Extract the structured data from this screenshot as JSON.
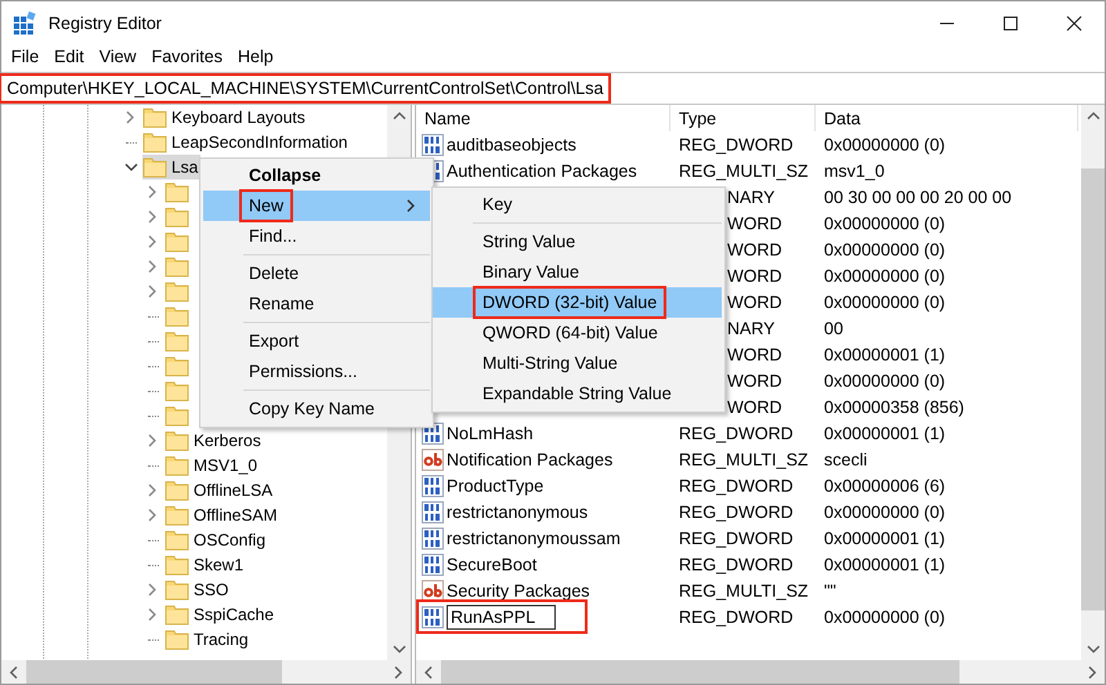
{
  "window": {
    "title": "Registry Editor"
  },
  "menu_bar": [
    "File",
    "Edit",
    "View",
    "Favorites",
    "Help"
  ],
  "address_bar": {
    "value": "Computer\\HKEY_LOCAL_MACHINE\\SYSTEM\\CurrentControlSet\\Control\\Lsa",
    "callout": true
  },
  "tree": {
    "items": [
      {
        "label": "Keyboard Layouts",
        "expandable": true,
        "expanded": false,
        "selected": false
      },
      {
        "label": "LeapSecondInformation",
        "expandable": false,
        "selected": false
      },
      {
        "label": "Lsa",
        "expandable": true,
        "expanded": true,
        "selected": true,
        "children": [
          {
            "expandable": true,
            "expanded": false,
            "selected": false
          },
          {
            "expandable": true,
            "expanded": false,
            "selected": false
          },
          {
            "expandable": true,
            "expanded": false,
            "selected": false
          },
          {
            "expandable": true,
            "expanded": false,
            "selected": false
          },
          {
            "expandable": true,
            "expanded": false,
            "selected": false
          },
          {
            "expandable": false,
            "selected": false
          },
          {
            "expandable": false,
            "selected": false
          },
          {
            "expandable": false,
            "selected": false
          },
          {
            "expandable": false,
            "selected": false
          },
          {
            "expandable": false,
            "selected": false
          },
          {
            "label": "Kerberos",
            "expandable": true,
            "expanded": false,
            "selected": false
          },
          {
            "label": "MSV1_0",
            "expandable": false,
            "selected": false
          },
          {
            "label": "OfflineLSA",
            "expandable": true,
            "expanded": false,
            "selected": false
          },
          {
            "label": "OfflineSAM",
            "expandable": true,
            "expanded": false,
            "selected": false
          },
          {
            "label": "OSConfig",
            "expandable": false,
            "selected": false
          },
          {
            "label": "Skew1",
            "expandable": false,
            "selected": false
          },
          {
            "label": "SSO",
            "expandable": true,
            "expanded": false,
            "selected": false
          },
          {
            "label": "SspiCache",
            "expandable": true,
            "expanded": false,
            "selected": false
          },
          {
            "label": "Tracing",
            "expandable": false,
            "selected": false
          }
        ]
      }
    ]
  },
  "values": {
    "columns": [
      "Name",
      "Type",
      "Data"
    ],
    "rows": [
      {
        "name": "auditbaseobjects",
        "type": "REG_DWORD",
        "data": "0x00000000 (0)",
        "kind": "binary",
        "covered": false
      },
      {
        "name": "Authentication Packages",
        "type": "REG_MULTI_SZ",
        "data": "msv1_0",
        "kind": "binary",
        "covered": false
      },
      {
        "type": "NARY",
        "data": "00 30 00 00 00 20 00 00",
        "covered": true
      },
      {
        "type": "WORD",
        "data": "0x00000000 (0)",
        "covered": true
      },
      {
        "type": "WORD",
        "data": "0x00000000 (0)",
        "covered": true
      },
      {
        "type": "WORD",
        "data": "0x00000000 (0)",
        "covered": true
      },
      {
        "type": "WORD",
        "data": "0x00000000 (0)",
        "covered": true
      },
      {
        "type": "NARY",
        "data": "00",
        "covered": true
      },
      {
        "type": "WORD",
        "data": "0x00000001 (1)",
        "covered": true
      },
      {
        "type": "WORD",
        "data": "0x00000000 (0)",
        "covered": true
      },
      {
        "type": "WORD",
        "data": "0x00000358 (856)",
        "covered": true
      },
      {
        "name": "NoLmHash",
        "type": "REG_DWORD",
        "data": "0x00000001 (1)",
        "kind": "binary",
        "covered": false
      },
      {
        "name": "Notification Packages",
        "type": "REG_MULTI_SZ",
        "data": "scecli",
        "kind": "string",
        "covered": false
      },
      {
        "name": "ProductType",
        "type": "REG_DWORD",
        "data": "0x00000006 (6)",
        "kind": "binary",
        "covered": false
      },
      {
        "name": "restrictanonymous",
        "type": "REG_DWORD",
        "data": "0x00000000 (0)",
        "kind": "binary",
        "covered": false
      },
      {
        "name": "restrictanonymoussam",
        "type": "REG_DWORD",
        "data": "0x00000001 (1)",
        "kind": "binary",
        "covered": false
      },
      {
        "name": "SecureBoot",
        "type": "REG_DWORD",
        "data": "0x00000001 (1)",
        "kind": "binary",
        "covered": false
      },
      {
        "name": "Security Packages",
        "type": "REG_MULTI_SZ",
        "data": "\"\"",
        "kind": "string",
        "covered": false
      },
      {
        "name": "RunAsPPL",
        "type": "REG_DWORD",
        "data": "0x00000000 (0)",
        "kind": "binary",
        "covered": false,
        "editing": true,
        "callout": true
      }
    ]
  },
  "context_menu": {
    "items": [
      {
        "kind": "item",
        "label": "Collapse",
        "default": true,
        "selected": false,
        "submenu": false,
        "callout": false
      },
      {
        "kind": "item",
        "label": "New",
        "default": false,
        "selected": true,
        "submenu": true,
        "callout": true
      },
      {
        "kind": "item",
        "label": "Find...",
        "default": false,
        "selected": false,
        "submenu": false,
        "callout": false
      },
      {
        "kind": "separator"
      },
      {
        "kind": "item",
        "label": "Delete",
        "default": false,
        "selected": false,
        "submenu": false,
        "callout": false
      },
      {
        "kind": "item",
        "label": "Rename",
        "default": false,
        "selected": false,
        "submenu": false,
        "callout": false
      },
      {
        "kind": "separator"
      },
      {
        "kind": "item",
        "label": "Export",
        "default": false,
        "selected": false,
        "submenu": false,
        "callout": false
      },
      {
        "kind": "item",
        "label": "Permissions...",
        "default": false,
        "selected": false,
        "submenu": false,
        "callout": false
      },
      {
        "kind": "separator"
      },
      {
        "kind": "item",
        "label": "Copy Key Name",
        "default": false,
        "selected": false,
        "submenu": false,
        "callout": false
      }
    ]
  },
  "submenu": {
    "items": [
      {
        "kind": "item",
        "label": "Key",
        "selected": false,
        "callout": false
      },
      {
        "kind": "separator"
      },
      {
        "kind": "item",
        "label": "String Value",
        "selected": false,
        "callout": false
      },
      {
        "kind": "item",
        "label": "Binary Value",
        "selected": false,
        "callout": false
      },
      {
        "kind": "item",
        "label": "DWORD (32-bit) Value",
        "selected": true,
        "callout": true
      },
      {
        "kind": "item",
        "label": "QWORD (64-bit) Value",
        "selected": false,
        "callout": false
      },
      {
        "kind": "item",
        "label": "Multi-String Value",
        "selected": false,
        "callout": false
      },
      {
        "kind": "item",
        "label": "Expandable String Value",
        "selected": false,
        "callout": false
      }
    ]
  }
}
